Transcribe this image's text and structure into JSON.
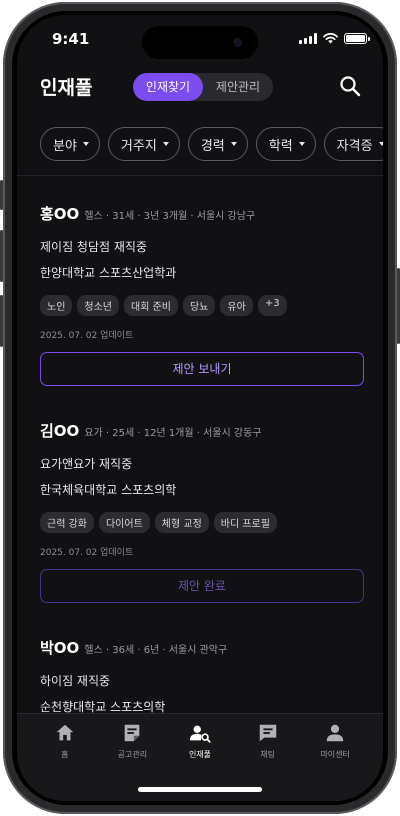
{
  "status_bar": {
    "time": "9:41"
  },
  "header": {
    "title": "인재풀",
    "segments": [
      "인재찾기",
      "제안관리"
    ],
    "active_segment": "인재찾기"
  },
  "filters": [
    "분야",
    "거주지",
    "경력",
    "학력",
    "자격증"
  ],
  "candidates": [
    {
      "name": "홍OO",
      "meta": "헬스 · 31세 · 3년 3개월 · 서울시 강남구",
      "line1": "제이짐 청담점 재직중",
      "line2": "한양대학교 스포츠산업학과",
      "tags": [
        "노인",
        "청소년",
        "대회 준비",
        "당뇨",
        "유아",
        "+3"
      ],
      "updated": "2025. 07. 02 업데이트",
      "button": "제안 보내기",
      "button_state": "active"
    },
    {
      "name": "김OO",
      "meta": "요가 · 25세 · 12년 1개월 · 서울시 강동구",
      "line1": "요가앤요가 재직중",
      "line2": "한국체육대학교 스포츠의학",
      "tags": [
        "근력 강화",
        "다이어트",
        "체형 교정",
        "바디 프로필"
      ],
      "updated": "2025. 07. 02 업데이트",
      "button": "제안 완료",
      "button_state": "done"
    },
    {
      "name": "박OO",
      "meta": "헬스 · 36세 · 6년 · 서울시 관악구",
      "line1": "하이짐 재직중",
      "line2": "순천향대학교 스포츠의학"
    }
  ],
  "tabbar": {
    "items": [
      {
        "label": "홈",
        "icon": "home-icon"
      },
      {
        "label": "공고관리",
        "icon": "posting-icon"
      },
      {
        "label": "인재풀",
        "icon": "talent-search-icon"
      },
      {
        "label": "채팅",
        "icon": "chat-icon"
      },
      {
        "label": "마이센터",
        "icon": "person-icon"
      }
    ],
    "active": "인재풀"
  },
  "colors": {
    "accent": "#7b4cf0",
    "background": "#111113"
  }
}
